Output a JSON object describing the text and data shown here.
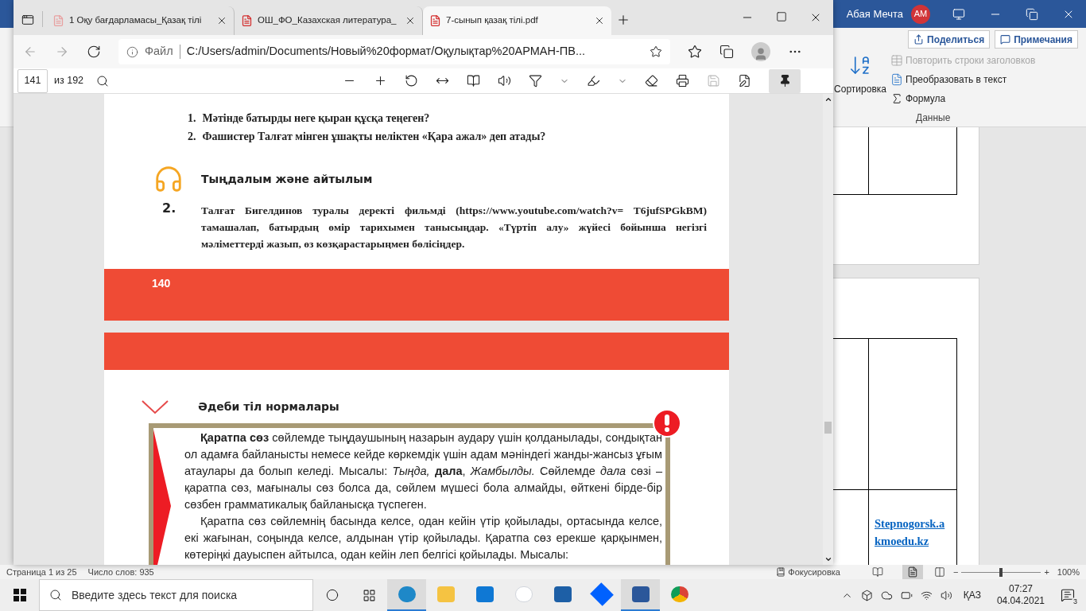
{
  "word": {
    "user_name": "Абая Мечта",
    "avatar_initials": "AM",
    "share_label": "Поделиться",
    "comments_label": "Примечания",
    "ribbon": {
      "sort_label": "Сортировка",
      "commands": [
        {
          "kind": "repeat",
          "label": "Повторить строки заголовков",
          "disabled": true
        },
        {
          "kind": "convert",
          "label": "Преобразовать в текст",
          "disabled": false
        },
        {
          "kind": "formula",
          "label": "Формула",
          "disabled": false
        }
      ],
      "group_label": "Данные"
    },
    "link_lines": [
      "Stepnogorsk.a",
      "kmoedu.kz"
    ],
    "status_bar": {
      "page": "Страница 1 из 25",
      "words": "Число слов: 935",
      "focus_label": "Фокусировка",
      "zoom_out": "−",
      "zoom_slider": {
        "level": 0.5
      },
      "zoom_in": "+",
      "zoom_text": "100%"
    }
  },
  "edge": {
    "tabs": [
      {
        "title": "1 Оқу бағдарламасы_Қазақ тілі",
        "selected": false
      },
      {
        "title": "ОШ_ФО_Казахская литература_",
        "selected": false
      },
      {
        "title": "7-сынып қазақ тілі.pdf",
        "selected": true
      }
    ],
    "address": {
      "scheme": "Файл",
      "url": "C:/Users/admin/Documents/Новый%20формат/Оқулықтар%20АРМАН-ПВ..."
    },
    "pdf_toolbar": {
      "page_number": "141",
      "page_count": "из 192",
      "save_enabled": false,
      "pinned": true
    },
    "pdf": {
      "questions": [
        {
          "number": "1.",
          "text": "Мәтінде батырды неге қыран құсқа теңеген?"
        },
        {
          "number": "2.",
          "text": "Фашистер Талғат мінген ұшақты неліктен «Қара ажал» деп атады?"
        }
      ],
      "section_title": "Тыңдалым және айтылым",
      "task_number": "2.",
      "task_text": "Талғат Бигелдинов туралы деректі фильмді (https://www.youtube.com/watch?v= T6jufSPGkBM) тамашалап, батырдың өмір тарихымен танысыңдар. «Түртіп алу» жүйесі бойынша негізгі мәліметтерді жазып, өз көзқарастарыңмен бөлісіңдер.",
      "page_number": "140",
      "section2_title": "Әдеби тіл нормалары",
      "box_paragraphs": [
        "**Қаратпа сөз** сөйлемде тыңдаушының назарын аудару үшін қолданылады, сондықтан ол адамға байланысты немесе кейде көркемдік үшін адам мәніндегі жанды-жансыз ұғым атаулары да болып келеді. Мысалы: *Тыңда,* **дала**, *Жамбылды.* Сөйлемде *дала* сөзі – қаратпа сөз, мағыналы сөз болса да, сөйлем мүшесі бола алмайды, өйткені бірде-бір сөзбен грамматикалық байланысқа түспеген.",
        "Қаратпа сөз сөйлемнің басында келсе, одан кейін үтір қойылады, ортасында келсе, екі жағынан, соңында келсе, алдынан үтір қойылады. Қаратпа сөз ерекше қарқынмен, көтеріңкі дауыспен айтылса, одан кейін леп белгісі қойылады. Мысалы:"
      ]
    }
  },
  "taskbar": {
    "search_placeholder": "Введите здесь текст для поиска",
    "apps": [
      {
        "kind": "edge",
        "running": true
      },
      {
        "kind": "explorer",
        "running": false
      },
      {
        "kind": "mail",
        "running": false
      },
      {
        "kind": "yandex",
        "running": false
      },
      {
        "kind": "bitrix",
        "running": false
      },
      {
        "kind": "dropbox",
        "running": false
      },
      {
        "kind": "word",
        "running": true
      },
      {
        "kind": "chrome",
        "running": false
      }
    ],
    "language": "ҚАЗ",
    "time": "07:27",
    "date": "04.04.2021",
    "notifications": "3"
  }
}
